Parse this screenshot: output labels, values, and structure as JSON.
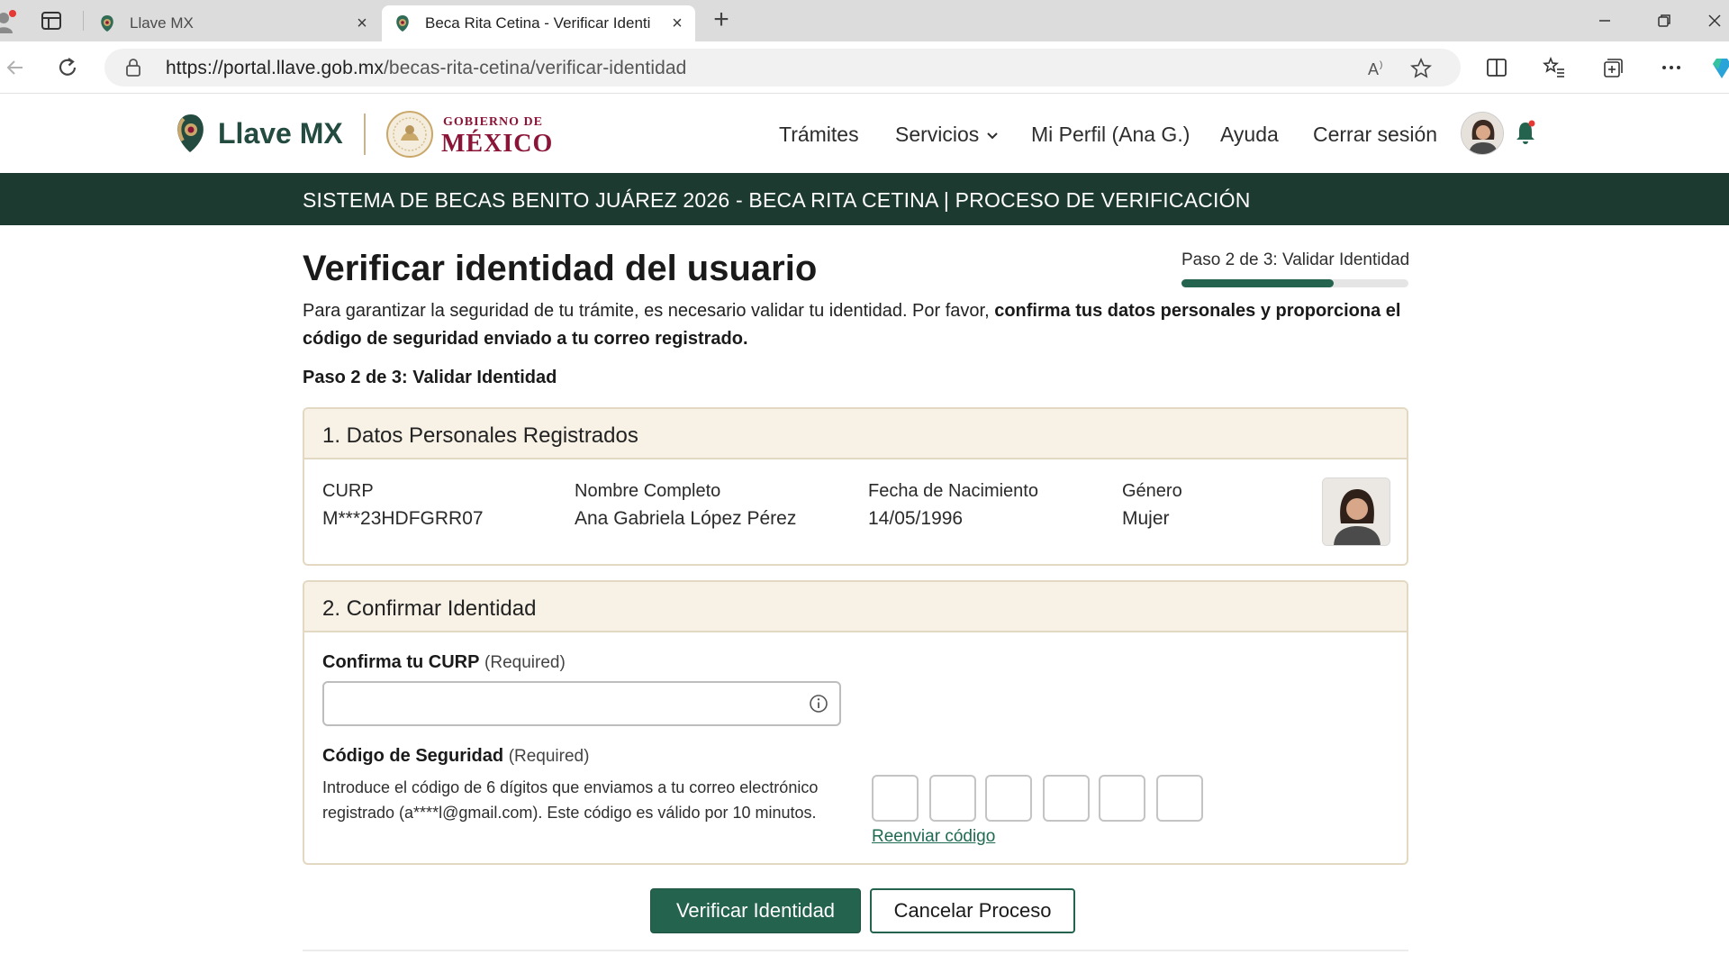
{
  "browser": {
    "tabs": [
      {
        "title": "Llave MX",
        "active": false
      },
      {
        "title": "Beca Rita Cetina - Verificar Identi",
        "active": true
      }
    ],
    "url_host": "https://portal.llave.gob.mx",
    "url_path": "/becas-rita-cetina/verificar-identidad"
  },
  "header": {
    "brand": "Llave MX",
    "gob_small": "GOBIERNO DE",
    "gob_big": "MÉXICO",
    "nav": [
      "Trámites",
      "Servicios",
      "Mi Perfil (Ana G.)",
      "Ayuda",
      "Cerrar sesión"
    ]
  },
  "banner": "SISTEMA DE BECAS BENITO JUÁREZ 2026 - BECA RITA CETINA | PROCESO DE VERIFICACIÓN",
  "page": {
    "title": "Verificar identidad del usuario",
    "step_indicator": "Paso 2 de 3: Validar Identidad",
    "progress": 0.67,
    "intro_normal": "Para garantizar la seguridad de tu trámite, es necesario validar tu identidad. Por favor, ",
    "intro_bold": "confirma tus datos personales y proporciona el código de seguridad enviado a tu correo registrado.",
    "step_label": "Paso 2 de 3: Validar Identidad"
  },
  "personal": {
    "title": "1. Datos Personales Registrados",
    "fields": [
      {
        "label": "CURP",
        "value": "M***23HDFGRR07"
      },
      {
        "label": "Nombre Completo",
        "value": "Ana Gabriela López Pérez"
      },
      {
        "label": "Fecha de Nacimiento",
        "value": "14/05/1996"
      },
      {
        "label": "Género",
        "value": "Mujer"
      }
    ]
  },
  "confirm": {
    "title": "2. Confirmar Identidad",
    "curp_label": "Confirma tu CURP",
    "curp_required": "(Required)",
    "curp_value": "",
    "code_label": "Código de Seguridad",
    "code_required": "(Required)",
    "code_help": "Introduce el código de 6 dígitos que enviamos a tu correo electrónico registrado (a****l@gmail.com). Este código es válido por 10 minutos.",
    "resend": "Reenviar código"
  },
  "actions": {
    "verify": "Verificar Identidad",
    "cancel": "Cancelar Proceso"
  },
  "colors": {
    "primary": "#24634d",
    "banner": "#1d3a30",
    "card_header": "#f7f1e6",
    "card_border": "#e3d8c2",
    "gob_red": "#8a1538"
  }
}
